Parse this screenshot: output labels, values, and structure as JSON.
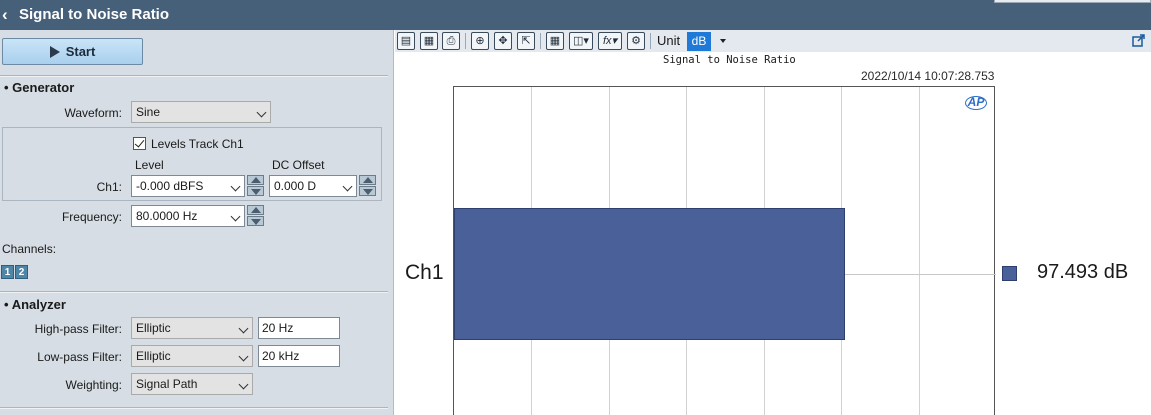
{
  "window": {
    "title": "Signal to Noise Ratio"
  },
  "left": {
    "start_label": "Start",
    "generator": {
      "heading": "Generator",
      "waveform_label": "Waveform:",
      "waveform_value": "Sine",
      "levels_track_label": "Levels Track Ch1",
      "levels_track_checked": true,
      "level_header": "Level",
      "dc_offset_header": "DC Offset",
      "ch1_label": "Ch1:",
      "ch1_level": "-0.000 dBFS",
      "ch1_dc_offset": "0.000 D",
      "frequency_label": "Frequency:",
      "frequency_value": "80.0000 Hz",
      "channels_label": "Channels:",
      "channel_buttons": [
        "1",
        "2"
      ]
    },
    "analyzer": {
      "heading": "Analyzer",
      "highpass_label": "High-pass Filter:",
      "highpass_type": "Elliptic",
      "highpass_freq": "20 Hz",
      "lowpass_label": "Low-pass Filter:",
      "lowpass_type": "Elliptic",
      "lowpass_freq": "20 kHz",
      "weighting_label": "Weighting:",
      "weighting_value": "Signal Path"
    }
  },
  "toolbar": {
    "unit_label": "Unit",
    "unit_value": "dB",
    "icons": [
      "save-icon",
      "save-all-icon",
      "print-icon",
      "zoom-icon",
      "pan-icon",
      "fit-icon",
      "table-icon",
      "graph-options-icon",
      "fx-icon",
      "settings-icon",
      "expand-icon"
    ]
  },
  "chart_data": {
    "type": "bar",
    "orientation": "horizontal",
    "title": "Signal to Noise Ratio",
    "timestamp": "2022/10/14 10:07:28.753",
    "categories": [
      "Ch1"
    ],
    "values": [
      97.493
    ],
    "value_label": "97.493 dB",
    "unit": "dB",
    "bar_color": "#4a6099",
    "grid": true,
    "logo": "AP"
  }
}
